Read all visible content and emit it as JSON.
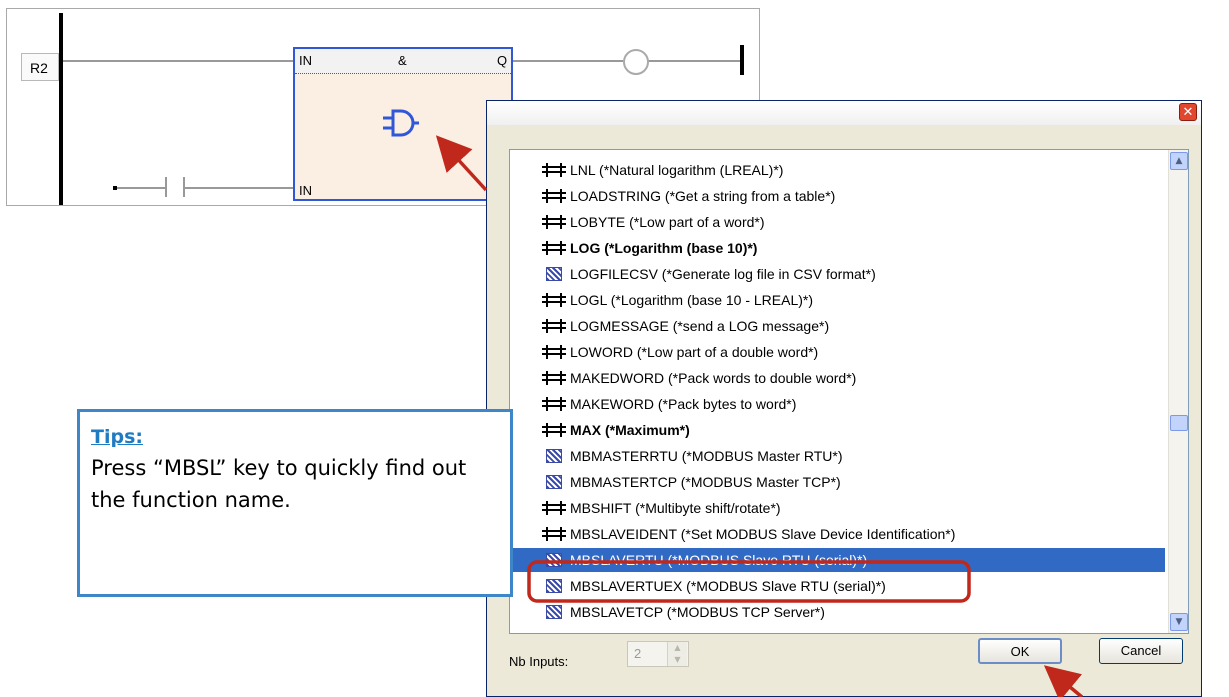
{
  "ladder": {
    "rung_label": "R2",
    "block": {
      "in1": "IN",
      "op": "&",
      "out": "Q",
      "in2": "IN"
    }
  },
  "dialog": {
    "close_glyph": "✕",
    "items": [
      {
        "label": "LNL (*Natural logarithm (LREAL)*)",
        "icon": "function-icon",
        "bold": false
      },
      {
        "label": "LOADSTRING (*Get a string from a table*)",
        "icon": "function-icon",
        "bold": false
      },
      {
        "label": "LOBYTE (*Low part of a word*)",
        "icon": "function-icon",
        "bold": false
      },
      {
        "label": "LOG (*Logarithm (base 10)*)",
        "icon": "function-icon",
        "bold": true
      },
      {
        "label": "LOGFILECSV (*Generate log file in CSV format*)",
        "icon": "function-block-icon",
        "bold": false
      },
      {
        "label": "LOGL (*Logarithm (base 10 - LREAL)*)",
        "icon": "function-icon",
        "bold": false
      },
      {
        "label": "LOGMESSAGE (*send a LOG message*)",
        "icon": "function-icon",
        "bold": false
      },
      {
        "label": "LOWORD (*Low part of a double word*)",
        "icon": "function-icon",
        "bold": false
      },
      {
        "label": "MAKEDWORD (*Pack words to double word*)",
        "icon": "function-icon",
        "bold": false
      },
      {
        "label": "MAKEWORD (*Pack bytes to word*)",
        "icon": "function-icon",
        "bold": false
      },
      {
        "label": "MAX (*Maximum*)",
        "icon": "function-icon",
        "bold": true
      },
      {
        "label": "MBMASTERRTU (*MODBUS Master RTU*)",
        "icon": "function-block-icon",
        "bold": false
      },
      {
        "label": "MBMASTERTCP (*MODBUS Master TCP*)",
        "icon": "function-block-icon",
        "bold": false
      },
      {
        "label": "MBSHIFT (*Multibyte shift/rotate*)",
        "icon": "function-icon",
        "bold": false
      },
      {
        "label": "MBSLAVEIDENT (*Set MODBUS Slave Device Identification*)",
        "icon": "function-icon",
        "bold": false
      },
      {
        "label": "MBSLAVERTU (*MODBUS Slave RTU (serial)*)",
        "icon": "function-block-icon",
        "bold": false,
        "selected": true
      },
      {
        "label": "MBSLAVERTUEX (*MODBUS Slave RTU (serial)*)",
        "icon": "function-block-icon",
        "bold": false
      },
      {
        "label": "MBSLAVETCP (*MODBUS TCP Server*)",
        "icon": "function-block-icon",
        "bold": false
      }
    ],
    "nb_inputs_label": "Nb Inputs:",
    "nb_inputs_value": "2",
    "ok_label": "OK",
    "cancel_label": "Cancel"
  },
  "tips": {
    "title": "Tips:",
    "body": "Press “MBSL” key to quickly find out the function name."
  },
  "colors": {
    "selection": "#316ac5",
    "callout_border": "#3d86c8",
    "arrow": "#c0281c",
    "highlight_box": "#c0281c",
    "block_border": "#2f57d8"
  }
}
